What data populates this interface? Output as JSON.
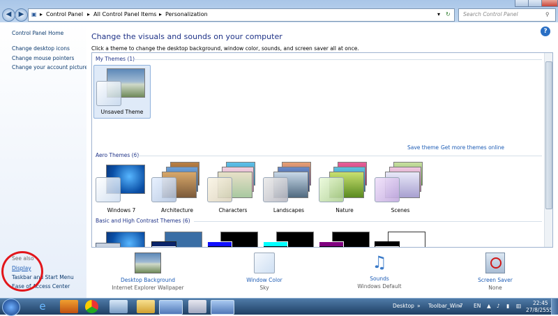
{
  "window": {
    "breadcrumbs": [
      "Control Panel",
      "All Control Panel Items",
      "Personalization"
    ],
    "search_placeholder": "Search Control Panel"
  },
  "sidebar": {
    "home": "Control Panel Home",
    "links": [
      "Change desktop icons",
      "Change mouse pointers",
      "Change your account picture"
    ],
    "see_also_title": "See also",
    "see_also": [
      "Display",
      "Taskbar and Start Menu",
      "Ease of Access Center"
    ]
  },
  "main": {
    "title": "Change the visuals and sounds on your computer",
    "subtitle": "Click a theme to change the desktop background, window color, sounds, and screen saver all at once.",
    "my_themes": {
      "heading": "My Themes (1)",
      "items": [
        "Unsaved Theme"
      ]
    },
    "links": {
      "save": "Save theme",
      "get_more": "Get more themes online"
    },
    "aero_themes": {
      "heading": "Aero Themes (6)",
      "items": [
        "Windows 7",
        "Architecture",
        "Characters",
        "Landscapes",
        "Nature",
        "Scenes"
      ]
    },
    "basic_themes": {
      "heading": "Basic and High Contrast Themes (6)"
    }
  },
  "bottom": [
    {
      "label": "Desktop Background",
      "sub": "Internet Explorer Wallpaper"
    },
    {
      "label": "Window Color",
      "sub": "Sky"
    },
    {
      "label": "Sounds",
      "sub": "Windows Default"
    },
    {
      "label": "Screen Saver",
      "sub": "None"
    }
  ],
  "taskbar": {
    "desktop": "Desktop",
    "toolbar": "Toolbar_Win7",
    "lang": "EN",
    "time": "22:45",
    "date": "27/8/2555"
  },
  "colors": {
    "accent": "#1e3287",
    "link": "#1d5cb5",
    "annotation": "#e2161b"
  }
}
